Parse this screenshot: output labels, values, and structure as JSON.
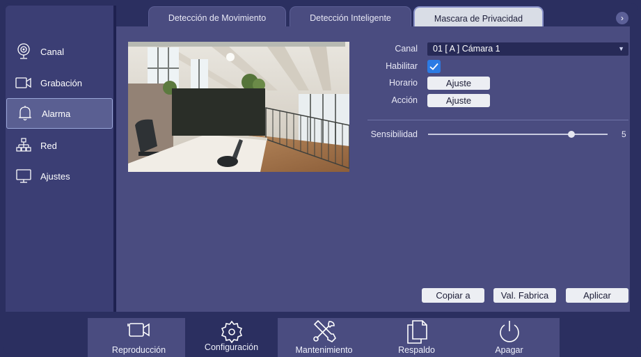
{
  "tabs": [
    {
      "label": "Detección de Movimiento"
    },
    {
      "label": "Detección Inteligente"
    },
    {
      "label": "Mascara de Privacidad"
    }
  ],
  "tab_next_glyph": "›",
  "sidebar": {
    "items": [
      {
        "label": "Canal",
        "icon": "camera-lens-icon"
      },
      {
        "label": "Grabación",
        "icon": "video-camera-icon"
      },
      {
        "label": "Alarma",
        "icon": "bell-icon"
      },
      {
        "label": "Red",
        "icon": "network-icon"
      },
      {
        "label": "Ajustes",
        "icon": "monitor-icon"
      }
    ],
    "active": "Alarma"
  },
  "form": {
    "canal_label": "Canal",
    "canal_value": "01 [ A ] Cámara 1",
    "habilitar_label": "Habilitar",
    "habilitar_checked": true,
    "horario_label": "Horario",
    "horario_button": "Ajuste",
    "accion_label": "Acción",
    "accion_button": "Ajuste",
    "sensibilidad_label": "Sensibilidad",
    "sensibilidad_value": "5",
    "sensibilidad_fraction": 0.8
  },
  "actions": {
    "copy": "Copiar a",
    "defaults": "Val. Fabrica",
    "apply": "Aplicar"
  },
  "bottom_bar": [
    {
      "label": "Reproducción",
      "icon": "video-camera-icon"
    },
    {
      "label": "Configuración",
      "icon": "gear-icon"
    },
    {
      "label": "Mantenimiento",
      "icon": "tools-icon"
    },
    {
      "label": "Respaldo",
      "icon": "copy-files-icon"
    },
    {
      "label": "Apagar",
      "icon": "power-icon"
    }
  ],
  "colors": {
    "background": "#2b2f60",
    "panel": "#4a4c80",
    "accent": "#2b7be4"
  }
}
